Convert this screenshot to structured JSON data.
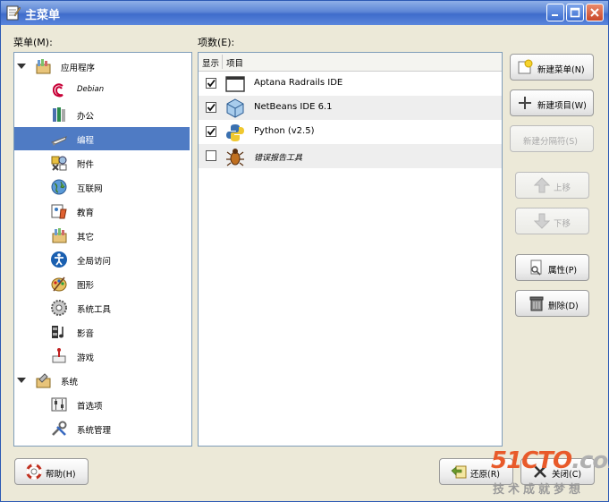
{
  "window": {
    "title": "主菜单"
  },
  "menus_label": "菜单(M):",
  "items_label": "项数(E):",
  "tree": [
    {
      "label": "应用程序",
      "icon": "applications-icon",
      "level": 0,
      "expanded": true
    },
    {
      "label": "Debian",
      "icon": "debian-icon",
      "level": 1
    },
    {
      "label": "办公",
      "icon": "office-icon",
      "level": 1
    },
    {
      "label": "编程",
      "icon": "programming-icon",
      "level": 1,
      "selected": true
    },
    {
      "label": "附件",
      "icon": "accessories-icon",
      "level": 1
    },
    {
      "label": "互联网",
      "icon": "internet-icon",
      "level": 1
    },
    {
      "label": "教育",
      "icon": "education-icon",
      "level": 1
    },
    {
      "label": "其它",
      "icon": "other-icon",
      "level": 1
    },
    {
      "label": "全局访问",
      "icon": "accessibility-icon",
      "level": 1
    },
    {
      "label": "图形",
      "icon": "graphics-icon",
      "level": 1
    },
    {
      "label": "系统工具",
      "icon": "system-tools-icon",
      "level": 1
    },
    {
      "label": "影音",
      "icon": "multimedia-icon",
      "level": 1
    },
    {
      "label": "游戏",
      "icon": "games-icon",
      "level": 1
    },
    {
      "label": "系统",
      "icon": "system-icon",
      "level": 0,
      "expanded": true
    },
    {
      "label": "首选项",
      "icon": "preferences-icon",
      "level": 1
    },
    {
      "label": "系统管理",
      "icon": "administration-icon",
      "level": 1
    }
  ],
  "items_header": {
    "show": "显示",
    "item": "项目"
  },
  "items": [
    {
      "label": "Aptana Radrails IDE",
      "checked": true,
      "icon": "window-icon"
    },
    {
      "label": "NetBeans IDE 6.1",
      "checked": true,
      "icon": "netbeans-icon"
    },
    {
      "label": "Python (v2.5)",
      "checked": true,
      "icon": "python-icon"
    },
    {
      "label": "错误报告工具",
      "checked": false,
      "icon": "bug-icon"
    }
  ],
  "buttons": {
    "new_menu": "新建菜单(N)",
    "new_item": "新建项目(W)",
    "new_separator": "新建分隔符(S)",
    "move_up": "上移",
    "move_down": "下移",
    "properties": "属性(P)",
    "delete": "删除(D)",
    "help": "帮助(H)",
    "revert": "还原(R)",
    "close": "关闭(C)"
  },
  "watermark": {
    "site": "51CTO",
    "suffix": ".com",
    "slogan": "技术成就梦想"
  },
  "colors": {
    "selection": "#4f7bc4",
    "titlebar": "#3f6ccb",
    "dialog_bg": "#ece9d8"
  }
}
